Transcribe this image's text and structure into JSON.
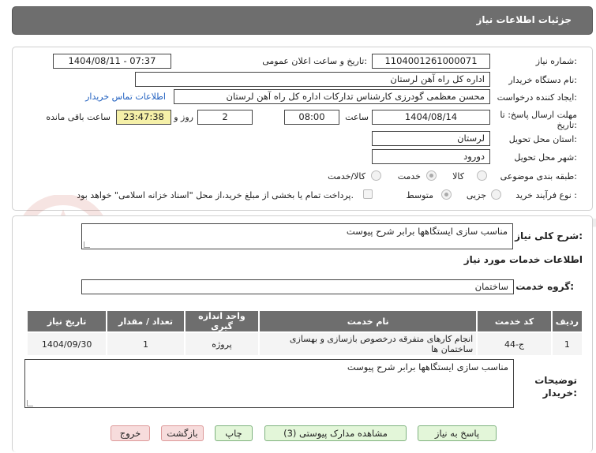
{
  "header": {
    "title": "جزئیات اطلاعات نیاز"
  },
  "info": {
    "need_number_label": "شماره نیاز:",
    "need_number": "1104001261000071",
    "announce_label": "تاریخ و ساعت اعلان عمومی:",
    "announce_value": "1404/08/11 - 07:37",
    "buyer_org_label": "نام دستگاه خریدار:",
    "buyer_org": "اداره کل راه آهن لرستان",
    "requester_label": "ایجاد کننده درخواست:",
    "requester": "محسن معظمی گودرزی کارشناس تدارکات اداره کل راه آهن لرستان",
    "contact_link": "اطلاعات تماس خریدار",
    "deadline_label": "مهلت ارسال پاسخ: تا تاریخ:",
    "deadline_date": "1404/08/14",
    "time_label": "ساعت",
    "deadline_time": "08:00",
    "days_value": "2",
    "days_label": "روز و",
    "remaining_time": "23:47:38",
    "remaining_label": "ساعت باقی مانده",
    "province_label": "استان محل تحویل:",
    "province": "لرستان",
    "city_label": "شهر محل تحویل:",
    "city": "دورود",
    "category_label": "طبقه بندی موضوعی:",
    "category_options": [
      "کالا",
      "خدمت",
      "کالا/خدمت"
    ],
    "category_selected": "خدمت",
    "process_label": "نوع فرآیند خرید :",
    "process_options": [
      "جزیی",
      "متوسط"
    ],
    "process_selected": "متوسط",
    "payment_note": "پرداخت تمام یا بخشی از مبلغ خرید،از محل \"اسناد خزانه اسلامی\" خواهد بود."
  },
  "summary": {
    "label": "شرح کلی نیاز:",
    "value": "مناسب سازی ایستگاهها برابر شرح پیوست"
  },
  "services": {
    "section_title": "اطلاعات خدمات مورد نیاز",
    "group_label": "گروه خدمت:",
    "group_value": "ساختمان",
    "table": {
      "headers": [
        "ردیف",
        "کد خدمت",
        "نام خدمت",
        "واحد اندازه گیری",
        "تعداد / مقدار",
        "تاریخ نیاز"
      ],
      "rows": [
        [
          "1",
          "ج-44",
          "انجام کارهای متفرقه درخصوص بازسازی و بهسازی ساختمان ها",
          "پروژه",
          "1",
          "1404/09/30"
        ]
      ]
    }
  },
  "notes": {
    "label": "توضیحات خریدار:",
    "value": "مناسب سازی ایستگاهها برابر شرح پیوست"
  },
  "watermark": {
    "text": "AriaTender.neT"
  },
  "buttons": {
    "reply": "پاسخ به نیاز",
    "docs": "مشاهده مدارک پیوستی (3)",
    "print": "چاپ",
    "back": "بازگشت",
    "exit": "خروج"
  }
}
